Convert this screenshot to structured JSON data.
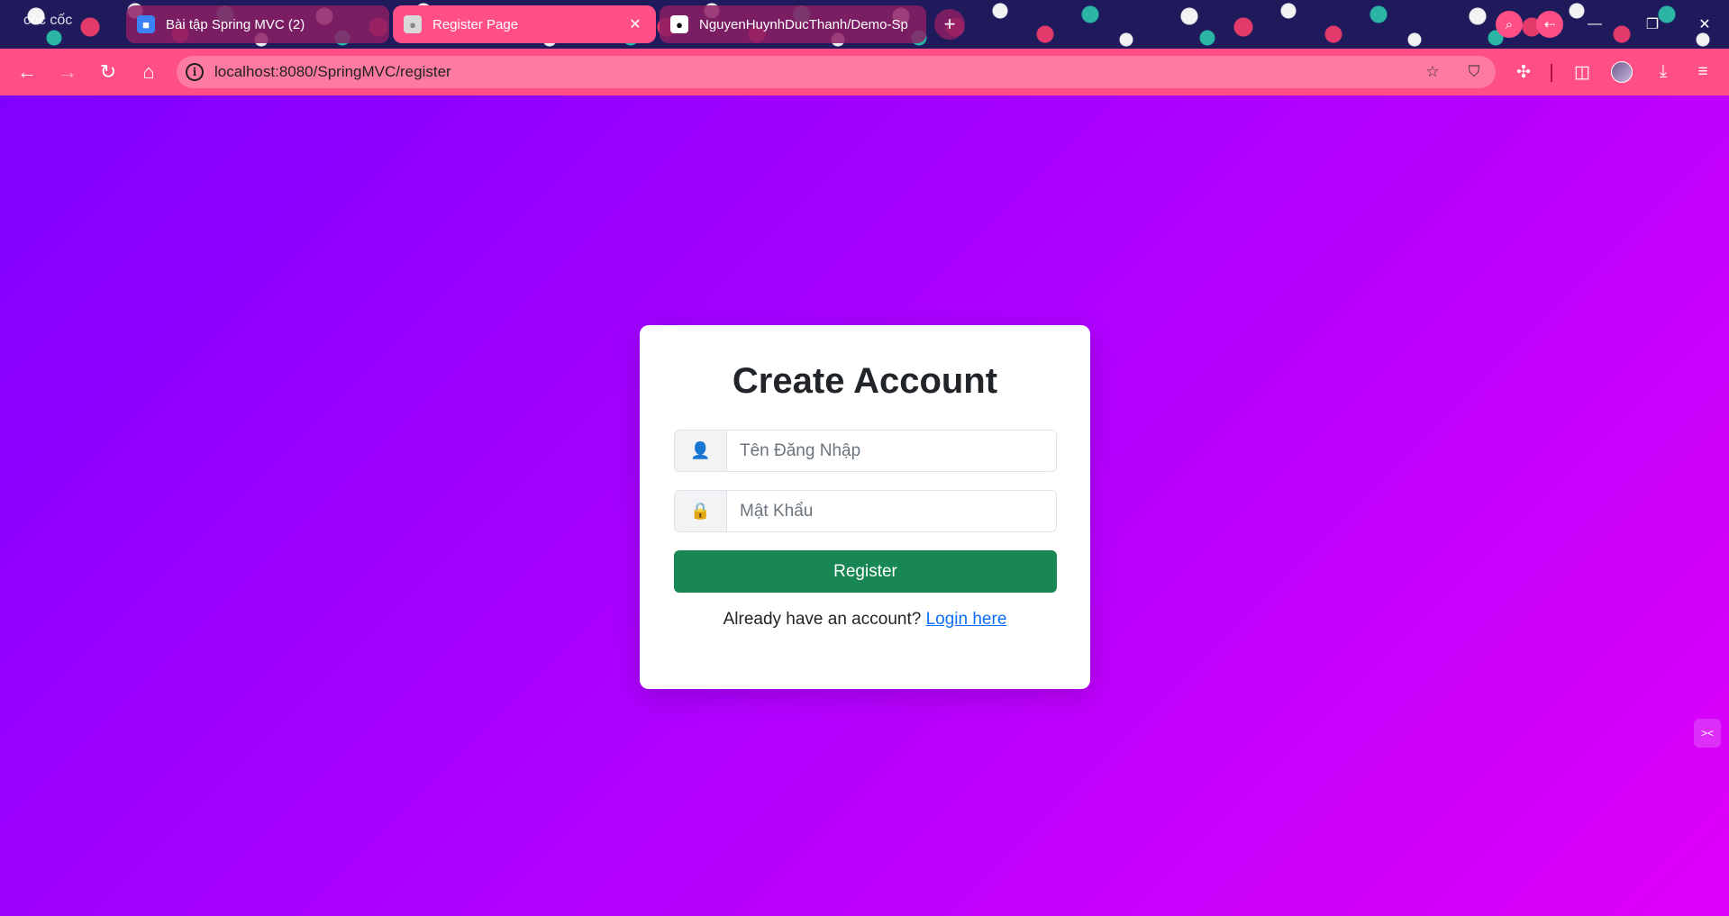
{
  "browser": {
    "brand": "cốc cốc",
    "tabs": [
      {
        "title": "Bài tập Spring MVC (2)",
        "favicon": "user-card-icon",
        "active": false
      },
      {
        "title": "Register Page",
        "favicon": "globe-icon",
        "active": true
      },
      {
        "title": "NguyenHuynhDucThanh/Demo-Sp",
        "favicon": "github-icon",
        "active": false
      }
    ],
    "new_tab_label": "+",
    "address": "localhost:8080/SpringMVC/register"
  },
  "colors": {
    "accent": "#ff4f86",
    "page_gradient_start": "#8000ff",
    "page_gradient_end": "#de00f8",
    "register_button": "#198754",
    "link": "#0d6efd"
  },
  "form": {
    "title": "Create Account",
    "username_placeholder": "Tên Đăng Nhập",
    "username_icon": "👤",
    "password_placeholder": "Mật Khẩu",
    "password_icon": "🔒",
    "submit_label": "Register",
    "login_prompt": "Already have an account?",
    "login_link": "Login here"
  }
}
